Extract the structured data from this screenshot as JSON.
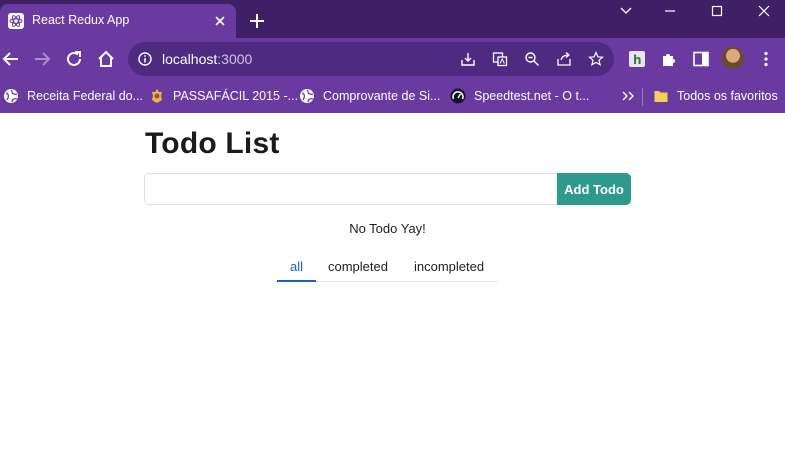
{
  "browser": {
    "tab": {
      "title": "React Redux App"
    },
    "omnibox": {
      "host": "localhost",
      "port": ":3000"
    },
    "bookmarks": [
      {
        "label": "Receita Federal do...",
        "icon": "globe-icon"
      },
      {
        "label": "PASSAFÁCIL 2015 -...",
        "icon": "badge-icon"
      },
      {
        "label": "Comprovante de Si...",
        "icon": "globe-icon"
      },
      {
        "label": "Speedtest.net - O t...",
        "icon": "speedtest-icon"
      }
    ],
    "all_bookmarks_label": "Todos os favoritos",
    "colors": {
      "frame": "#3f2066",
      "toolbar": "#6b3aa0",
      "omnibox": "#4e2a80"
    }
  },
  "app": {
    "title": "Todo List",
    "input": {
      "value": "",
      "placeholder": ""
    },
    "add_button_label": "Add Todo",
    "empty_message": "No Todo Yay!",
    "filters": [
      {
        "label": "all",
        "active": true
      },
      {
        "label": "completed",
        "active": false
      },
      {
        "label": "incompleted",
        "active": false
      }
    ],
    "colors": {
      "accent": "#2e9a8e",
      "active_tab": "#1e5fbf"
    }
  }
}
